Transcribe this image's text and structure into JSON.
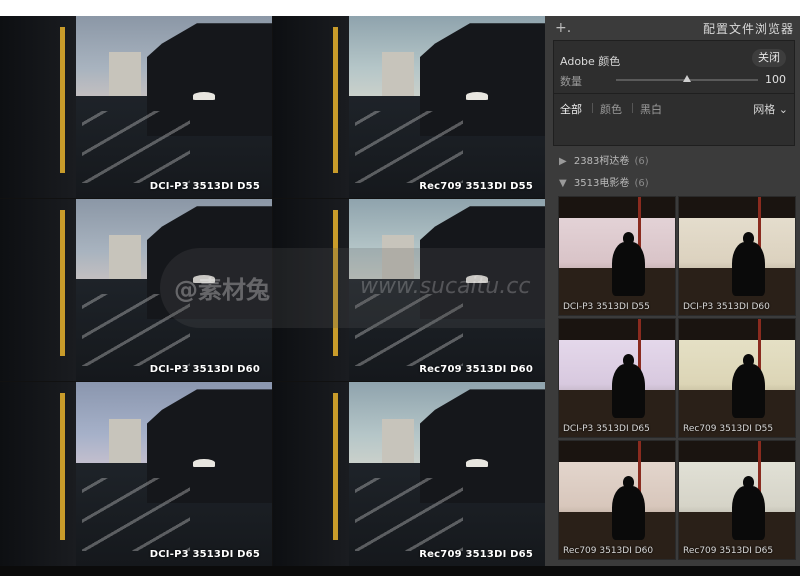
{
  "comparison_tiles": [
    {
      "caption": "DCI-P3 3513DI D55",
      "tone": "sky-a"
    },
    {
      "caption": "Rec709  3513DI D55",
      "tone": "sky-b"
    },
    {
      "caption": "DCI-P3 3513DI D60",
      "tone": "sky-a"
    },
    {
      "caption": "Rec709  3513DI D60",
      "tone": "sky-b"
    },
    {
      "caption": "DCI-P3 3513DI D65",
      "tone": "sky-c"
    },
    {
      "caption": "Rec709  3513DI D65",
      "tone": "sky-b"
    }
  ],
  "watermark": {
    "cn": "@素材兔",
    "en": "www.sucaitu.cc"
  },
  "panel": {
    "title": "配置文件浏览器",
    "add_icon": "plus-icon",
    "profile": {
      "name": "Adobe 颜色",
      "close_label": "关闭",
      "amount_label": "数量",
      "amount_value": "100",
      "amount_level_percent": 50
    },
    "filters": {
      "all": "全部",
      "color": "颜色",
      "bw": "黑白",
      "view_mode": "网格"
    },
    "groups": [
      {
        "name": "2383柯达卷",
        "count": "(6)",
        "expanded": false
      },
      {
        "name": "3513电影卷",
        "count": "(6)",
        "expanded": true
      }
    ],
    "thumbnails": [
      {
        "caption": "DCI-P3 3513DI D55",
        "tone": "tone-1"
      },
      {
        "caption": "DCI-P3 3513DI D60",
        "tone": "tone-2"
      },
      {
        "caption": "DCI-P3 3513DI D65",
        "tone": "tone-3"
      },
      {
        "caption": "Rec709  3513DI D55",
        "tone": "tone-4"
      },
      {
        "caption": "Rec709 3513DI D60",
        "tone": "tone-5"
      },
      {
        "caption": "Rec709 3513DI D65",
        "tone": "tone-6"
      }
    ]
  }
}
